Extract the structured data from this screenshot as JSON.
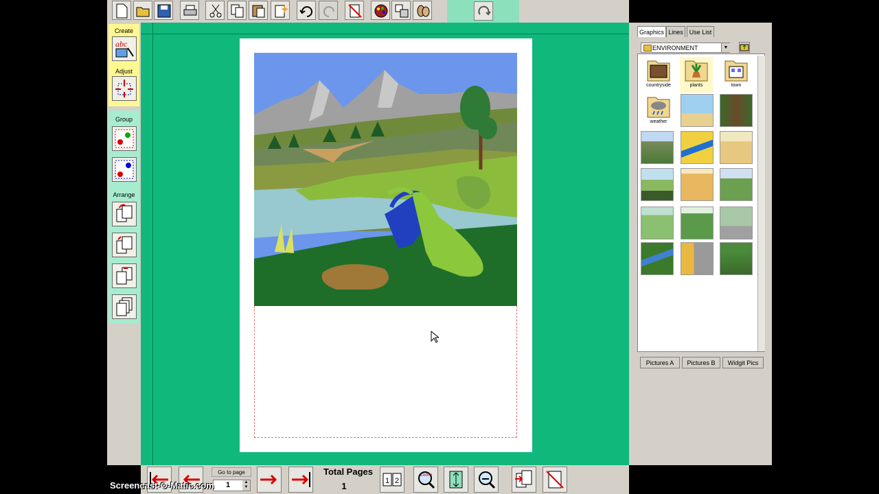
{
  "left_panel": {
    "create_label": "Create",
    "adjust_label": "Adjust",
    "group_label": "Group",
    "arrange_label": "Arrange"
  },
  "right_panel": {
    "tabs": [
      "Graphics",
      "Lines",
      "Use List"
    ],
    "folder_select": "ENVIRONMENT",
    "folders": [
      "countryside",
      "plants",
      "town",
      "weather"
    ],
    "bottom_buttons": [
      "Pictures A",
      "Pictures B",
      "Widgit Pics"
    ]
  },
  "bottom_bar": {
    "goto_label": "Go to page",
    "page_value": "1",
    "total_pages_label": "Total Pages",
    "total_pages_value": "1",
    "page_icon_text": "1|2"
  },
  "watermark": "Screencast-O-Matic.com",
  "colors": {
    "canvas": "#10b87c",
    "panel": "#d4d0c8",
    "accent_teal": "#8ce0bc",
    "margin_guide": "#e07070"
  }
}
